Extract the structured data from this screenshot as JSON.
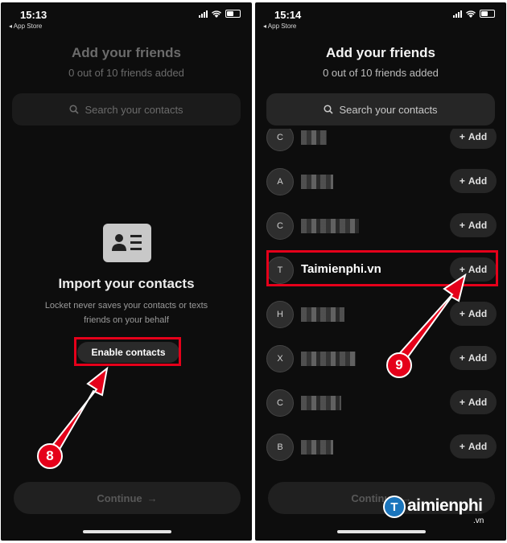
{
  "left_screen": {
    "status": {
      "time": "15:13",
      "back_app": "◂ App Store"
    },
    "title": "Add your friends",
    "subtitle": "0 out of 10 friends added",
    "search_placeholder": "Search your contacts",
    "import_title": "Import your contacts",
    "import_desc": "Locket never saves your contacts or texts friends on your behalf",
    "enable_button": "Enable contacts",
    "continue_button": "Continue",
    "step_badge": "8"
  },
  "right_screen": {
    "status": {
      "time": "15:14",
      "back_app": "◂ App Store"
    },
    "title": "Add your friends",
    "subtitle": "0 out of 10 friends added",
    "search_placeholder": "Search your contacts",
    "add_label": "Add",
    "contacts": [
      {
        "initial": "C",
        "name": ""
      },
      {
        "initial": "A",
        "name": ""
      },
      {
        "initial": "C",
        "name": ""
      },
      {
        "initial": "T",
        "name": "Taimienphi.vn"
      },
      {
        "initial": "H",
        "name": ""
      },
      {
        "initial": "X",
        "name": ""
      },
      {
        "initial": "C",
        "name": ""
      },
      {
        "initial": "B",
        "name": ""
      }
    ],
    "continue_button": "Continue",
    "step_badge": "9"
  },
  "watermark": {
    "brand": "aimienphi",
    "logo_letter": "T",
    "suffix": ".vn"
  },
  "colors": {
    "highlight": "#e5001a",
    "screen_bg": "#0d0d0d",
    "button_bg": "#262626"
  },
  "icons": [
    "search-icon",
    "contact-card-icon",
    "arrow-right-icon",
    "plus-icon",
    "signal-icon",
    "wifi-icon",
    "battery-icon"
  ]
}
